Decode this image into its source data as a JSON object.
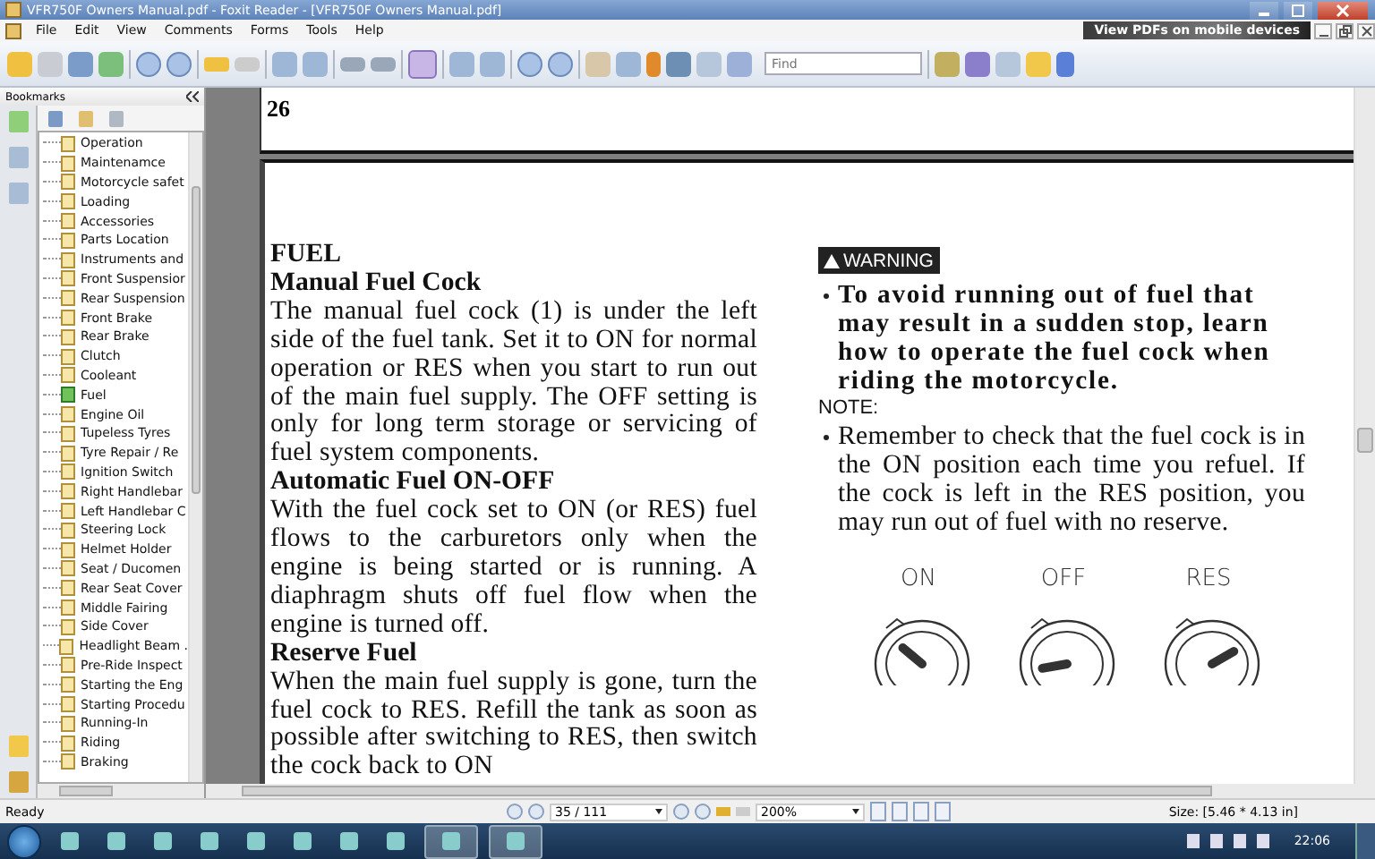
{
  "window": {
    "title": "VFR750F Owners Manual.pdf - Foxit Reader - [VFR750F Owners Manual.pdf]"
  },
  "menu": [
    "File",
    "Edit",
    "View",
    "Comments",
    "Forms",
    "Tools",
    "Help"
  ],
  "promo": "View PDFs on mobile devices",
  "find": {
    "placeholder": "Find"
  },
  "sidebar": {
    "title": "Bookmarks",
    "items": [
      {
        "label": "Operation",
        "selected": false
      },
      {
        "label": "Maintenamce",
        "selected": false
      },
      {
        "label": "Motorcycle safet",
        "selected": false
      },
      {
        "label": "Loading",
        "selected": false
      },
      {
        "label": "Accessories",
        "selected": false
      },
      {
        "label": "Parts Location",
        "selected": false
      },
      {
        "label": "Instruments and",
        "selected": false
      },
      {
        "label": "Front Suspensior",
        "selected": false
      },
      {
        "label": "Rear Suspension",
        "selected": false
      },
      {
        "label": "Front Brake",
        "selected": false
      },
      {
        "label": "Rear Brake",
        "selected": false
      },
      {
        "label": "Clutch",
        "selected": false
      },
      {
        "label": "Cooleant",
        "selected": false
      },
      {
        "label": "Fuel",
        "selected": true
      },
      {
        "label": "Engine Oil",
        "selected": false
      },
      {
        "label": "Tupeless Tyres",
        "selected": false
      },
      {
        "label": "Tyre Repair / Re",
        "selected": false
      },
      {
        "label": "Ignition Switch",
        "selected": false
      },
      {
        "label": "Right Handlebar",
        "selected": false
      },
      {
        "label": "Left Handlebar C",
        "selected": false
      },
      {
        "label": "Steering Lock",
        "selected": false
      },
      {
        "label": "Helmet Holder",
        "selected": false
      },
      {
        "label": "Seat / Ducomen",
        "selected": false
      },
      {
        "label": "Rear Seat Cover",
        "selected": false
      },
      {
        "label": "Middle Fairing",
        "selected": false
      },
      {
        "label": "Side Cover",
        "selected": false
      },
      {
        "label": "Headlight Beam .",
        "selected": false
      },
      {
        "label": "Pre-Ride Inspect",
        "selected": false
      },
      {
        "label": "Starting the Eng",
        "selected": false
      },
      {
        "label": "Starting Procedu",
        "selected": false
      },
      {
        "label": "Running-In",
        "selected": false
      },
      {
        "label": "Riding",
        "selected": false
      },
      {
        "label": "Braking",
        "selected": false
      }
    ]
  },
  "previous_page": {
    "number": "26"
  },
  "page": {
    "left": [
      {
        "kind": "title",
        "text": "FUEL"
      },
      {
        "kind": "heading",
        "text": "Manual Fuel Cock"
      },
      {
        "kind": "para",
        "text": "The manual fuel cock (1) is under the left side of the fuel tank. Set it to ON for normal operation or RES when you start to run out of the main fuel supply. The OFF setting is only for long term storage or servicing of fuel system components."
      },
      {
        "kind": "heading",
        "text": "Automatic Fuel ON-OFF"
      },
      {
        "kind": "para",
        "text": "With the fuel cock set to ON (or RES) fuel flows to the carburetors only when the engine is being started or is running. A diaphragm shuts off fuel flow when the engine is turned off."
      },
      {
        "kind": "heading",
        "text": "Reserve Fuel"
      },
      {
        "kind": "para",
        "text": "When the main fuel supply is gone, turn the fuel cock to RES. Refill the tank as soon as possible after switching to RES, then switch the cock back to ON"
      }
    ],
    "warning": {
      "label": "WARNING",
      "text": "To avoid running out of fuel that may result in a sudden stop, learn how to operate the fuel cock when riding the motorcycle."
    },
    "note": {
      "label": "NOTE:",
      "text": "Remember to check that the fuel cock is in the ON position each time you refuel. If the cock is left in the RES position, you may run out of fuel with no reserve."
    },
    "dials": [
      "ON",
      "OFF",
      "RES"
    ]
  },
  "status_bar": {
    "text": "Ready",
    "page": "35 / 111",
    "zoom": "200%",
    "size": "Size: [5.46 * 4.13 in]"
  },
  "taskbar": {
    "clock": "22:06"
  }
}
